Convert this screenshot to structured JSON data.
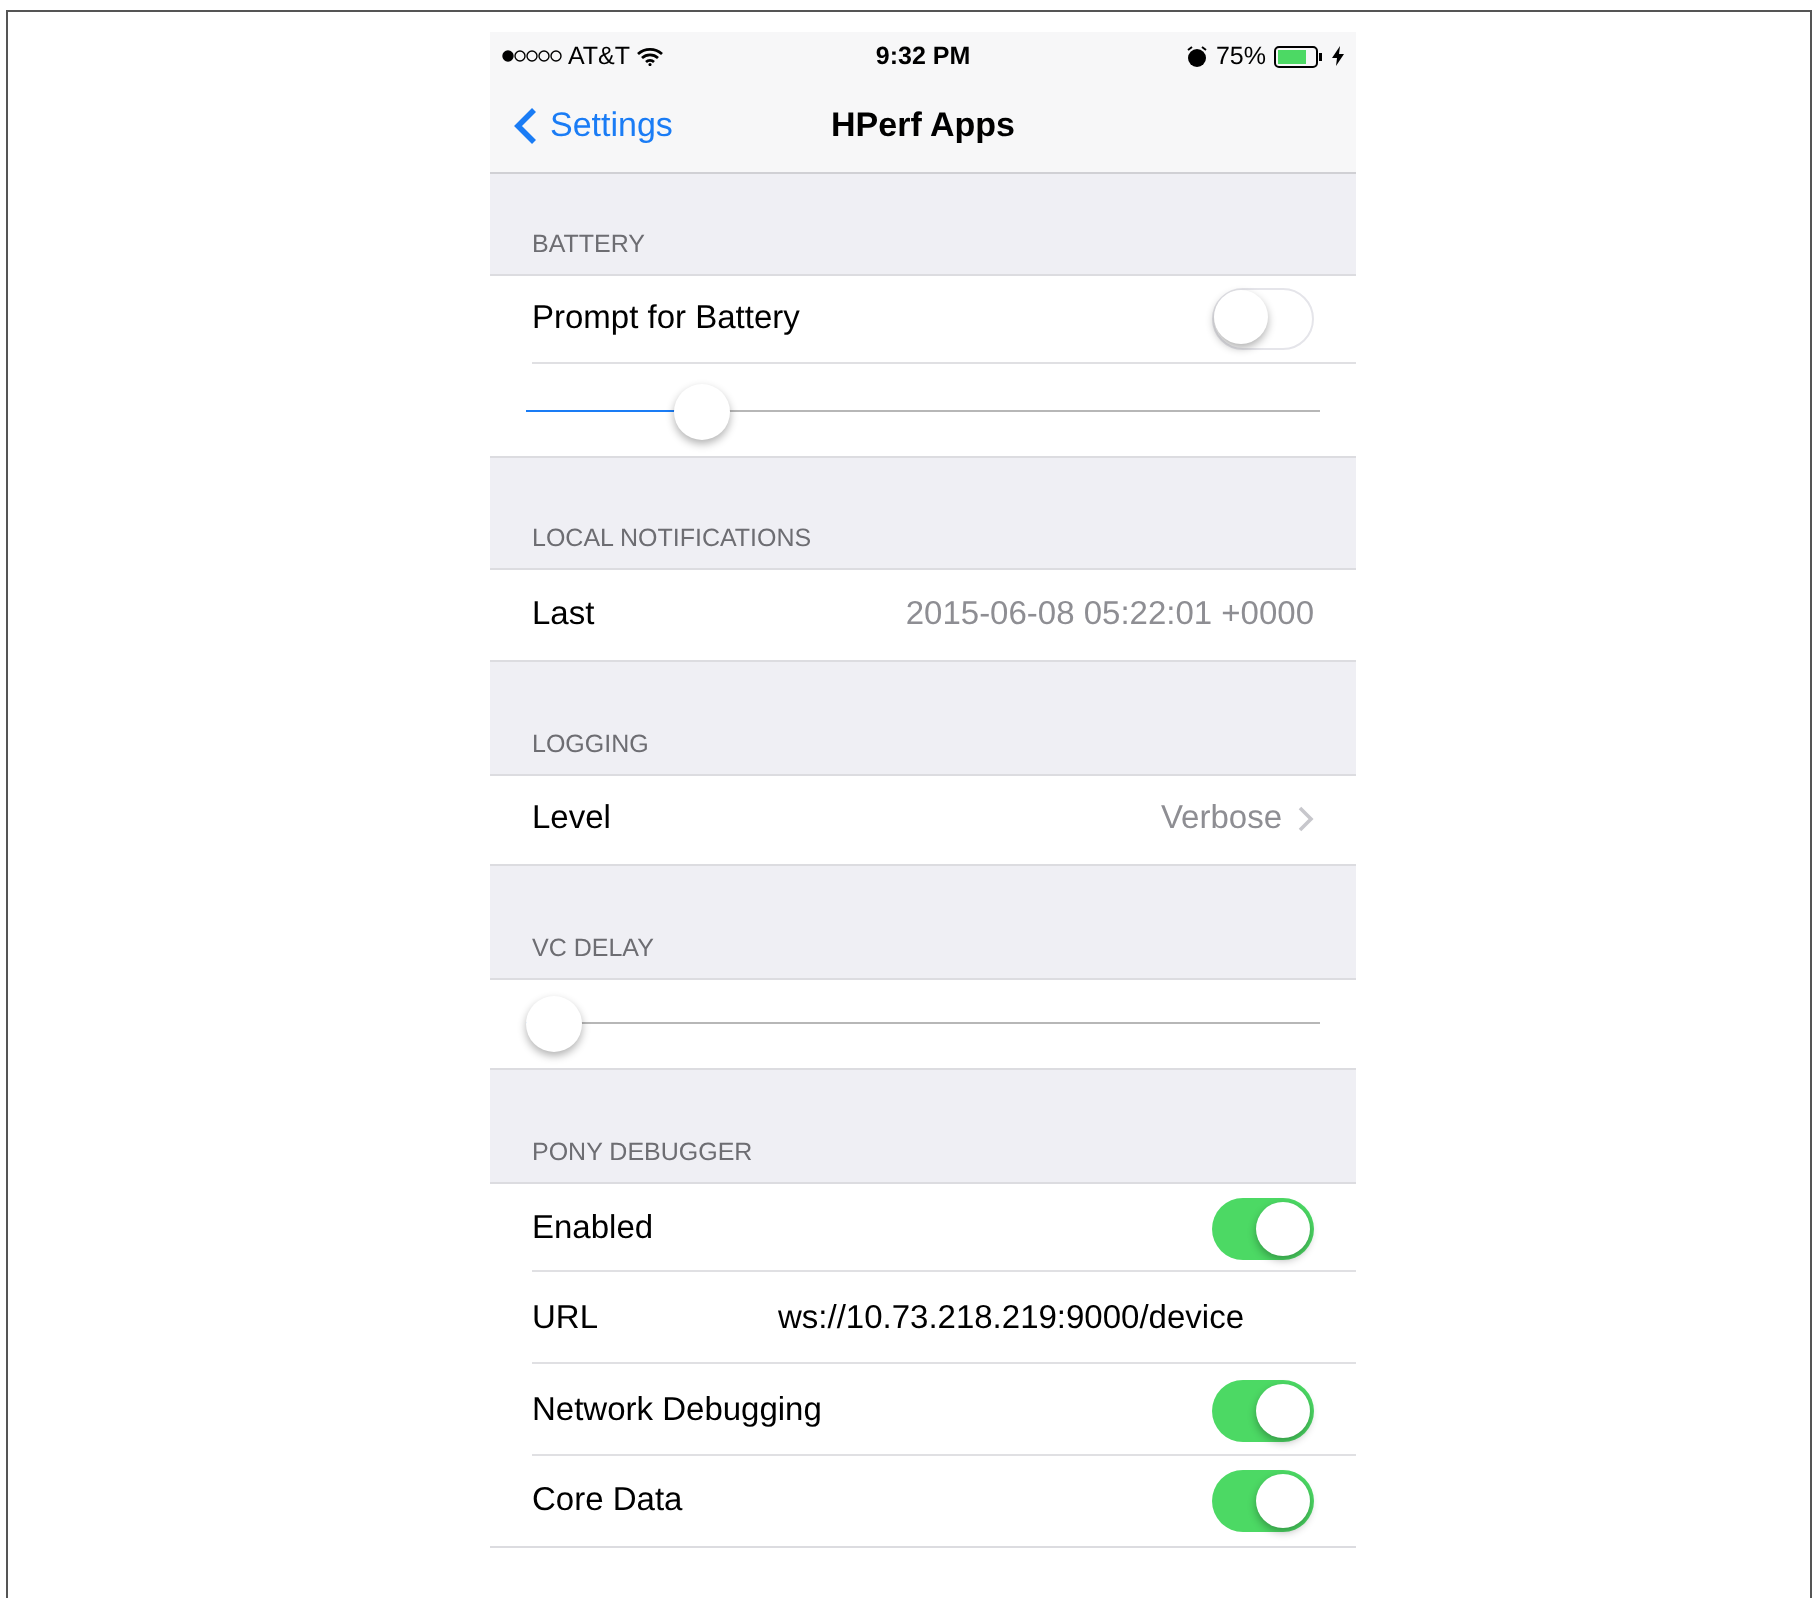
{
  "status_bar": {
    "carrier": "AT&T",
    "time": "9:32 PM",
    "battery_percent": "75%"
  },
  "nav": {
    "back": "Settings",
    "title": "HPerf Apps"
  },
  "sections": [
    {
      "header": "BATTERY",
      "rows": [
        {
          "kind": "toggle",
          "label": "Prompt for Battery",
          "on": false
        },
        {
          "kind": "slider",
          "level": 0.2
        }
      ]
    },
    {
      "header": "LOCAL NOTIFICATIONS",
      "rows": [
        {
          "kind": "value",
          "label": "Last",
          "value": "2015-06-08 05:22:01 +0000"
        }
      ]
    },
    {
      "header": "LOGGING",
      "rows": [
        {
          "kind": "disclosure",
          "label": "Level",
          "value": "Verbose"
        }
      ]
    },
    {
      "header": "VC DELAY",
      "rows": [
        {
          "kind": "slider",
          "level": 0
        }
      ]
    },
    {
      "header": "PONY DEBUGGER",
      "rows": [
        {
          "kind": "toggle",
          "label": "Enabled",
          "on": true
        },
        {
          "kind": "text",
          "label": "URL",
          "value": "ws://10.73.218.219:9000/device"
        },
        {
          "kind": "toggle",
          "label": "Network Debugging",
          "on": true
        },
        {
          "kind": "toggle",
          "label": "Core Data",
          "on": true
        }
      ]
    }
  ]
}
